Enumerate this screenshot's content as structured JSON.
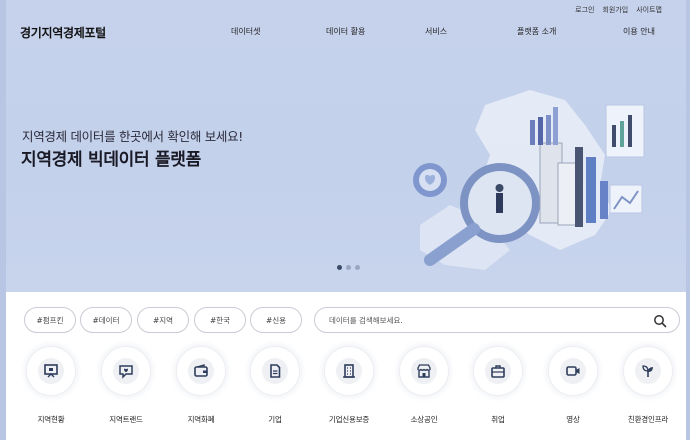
{
  "header": {
    "logo": "경기지역경제포털",
    "util_links": [
      "로그인",
      "회원가입",
      "사이트맵"
    ],
    "nav": [
      "데이터셋",
      "데이터 활용",
      "서비스",
      "플랫폼 소개",
      "이용 안내"
    ]
  },
  "hero": {
    "subtitle": "지역경제 데이터를 한곳에서 확인해 보세요!",
    "title": "지역경제 빅데이터 플랫폼",
    "slides": 3,
    "active_slide": 1
  },
  "tags": [
    "#펌프킨",
    "#데이터",
    "#지역",
    "#한국",
    "#신용"
  ],
  "search": {
    "placeholder": "데이터를 검색해보세요.",
    "value": ""
  },
  "categories": [
    {
      "label": "지역현황",
      "icon": "presentation-board-icon"
    },
    {
      "label": "지역트랜드",
      "icon": "chat-heart-icon"
    },
    {
      "label": "지역화폐",
      "icon": "wallet-icon"
    },
    {
      "label": "기업",
      "icon": "document-icon"
    },
    {
      "label": "기업신용보증",
      "icon": "building-icon"
    },
    {
      "label": "소상공인",
      "icon": "storefront-icon"
    },
    {
      "label": "취업",
      "icon": "briefcase-icon"
    },
    {
      "label": "영상",
      "icon": "video-camera-icon"
    },
    {
      "label": "친환경인프라",
      "icon": "eco-plant-icon"
    }
  ],
  "colors": {
    "hero_bg": "#c6d2ec",
    "icon_color": "#2f3d5c",
    "active_dot": "#3b4a66"
  }
}
